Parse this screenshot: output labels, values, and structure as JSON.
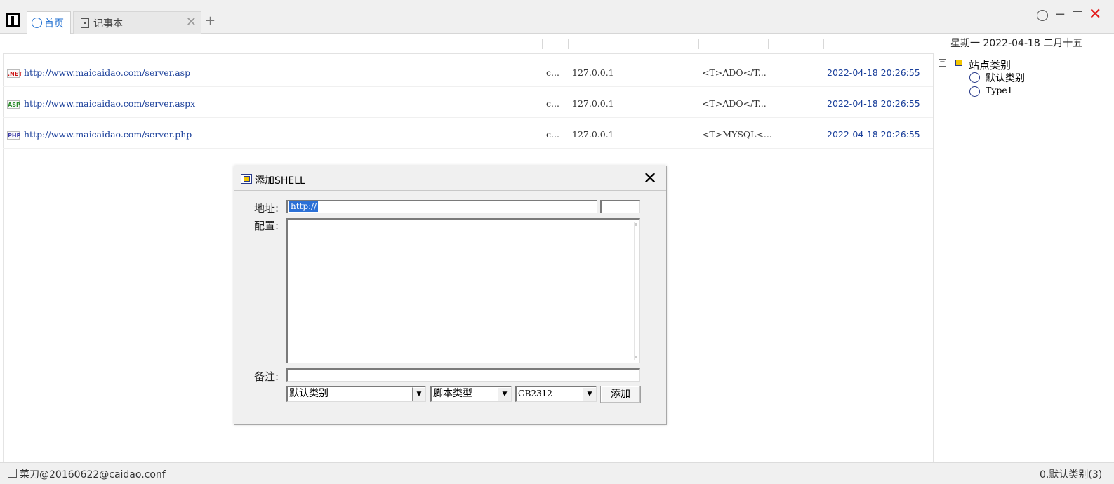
{
  "window": {
    "tabs": [
      {
        "label": "首页",
        "icon": "circle-icon",
        "active": true
      },
      {
        "label": "记事本",
        "icon": "document-icon",
        "active": false
      }
    ],
    "tab_close_glyph": "✕",
    "tab_add_glyph": "+",
    "controls": {
      "minimize": "−",
      "close": "✕"
    }
  },
  "header": {
    "date_info": "星期一 2022-04-18 二月十五"
  },
  "sites": [
    {
      "type_icon": ".NET",
      "url": "http://www.maicaidao.com/server.asp",
      "note": "c...",
      "ip": "127.0.0.1",
      "db_type": "<T>ADO</T...",
      "time": "2022-04-18 20:26:55"
    },
    {
      "type_icon": "ASP",
      "url": "http://www.maicaidao.com/server.aspx",
      "note": "c...",
      "ip": "127.0.0.1",
      "db_type": "<T>ADO</T...",
      "time": "2022-04-18 20:26:55"
    },
    {
      "type_icon": "PHP",
      "url": "http://www.maicaidao.com/server.php",
      "note": "c...",
      "ip": "127.0.0.1",
      "db_type": "<T>MYSQL<...",
      "time": "2022-04-18 20:26:55"
    }
  ],
  "tree": {
    "collapse_glyph": "−",
    "root": "站点类别",
    "children": [
      "默认类别",
      "Type1"
    ]
  },
  "status": {
    "left": "菜刀@20160622@caidao.conf",
    "right": "0.默认类别(3)"
  },
  "dialog": {
    "title": "添加SHELL",
    "close_glyph": "✕",
    "address_label": "地址:",
    "address_value": "http://",
    "config_label": "配置:",
    "memo_label": "备注:",
    "category_value": "默认类别",
    "script_type_value": "脚本类型",
    "charset_value": "GB2312",
    "dropdown_glyph": "▼",
    "add_button": "添加"
  }
}
